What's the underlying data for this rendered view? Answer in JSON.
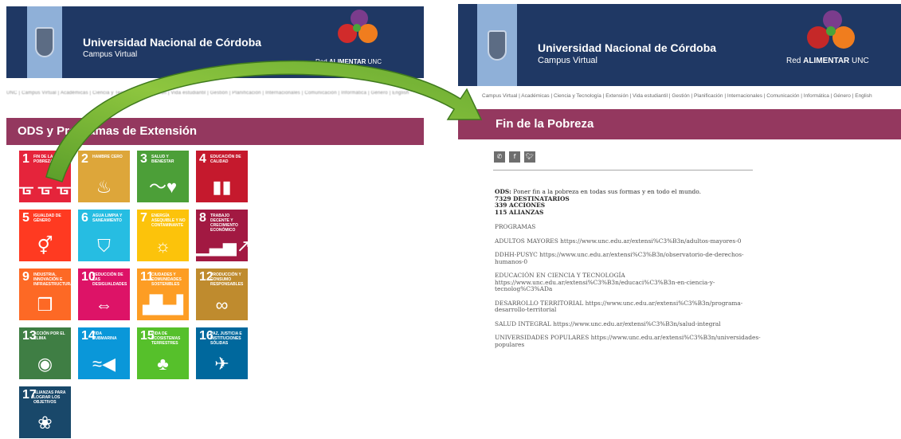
{
  "colors": {
    "header_bg": "#1f3864",
    "band_bg": "#94385f",
    "arrow_green": "#7dbb3a"
  },
  "left": {
    "header": {
      "title": "Universidad Nacional de Córdoba",
      "subtitle": "Campus Virtual",
      "logo_prefix": "Red ",
      "logo_bold": "ALIMENTAR",
      "logo_suffix": " UNC"
    },
    "nav_blurred": "UNC | Campus Virtual | Académicas | Ciencia y Tecnología | Extensión | Vida estudiantil | Gestión | Planificación | Internacionales | Comunicación | Informática | Género | English",
    "section_title": "ODS y Programas de Extensión",
    "tiles": [
      {
        "num": "1",
        "label": "Fin de la pobreza",
        "icon": "family-icon",
        "glyph": "ᚗ ᚗ ᚗ",
        "color": "#e5243b"
      },
      {
        "num": "2",
        "label": "Hambre cero",
        "icon": "bowl-icon",
        "glyph": "♨",
        "color": "#dda63a"
      },
      {
        "num": "3",
        "label": "Salud y bienestar",
        "icon": "heartbeat-icon",
        "glyph": "〜♥",
        "color": "#4c9f38"
      },
      {
        "num": "4",
        "label": "Educación de calidad",
        "icon": "book-icon",
        "glyph": "▮▮",
        "color": "#c5192d"
      },
      {
        "num": "5",
        "label": "Igualdad de género",
        "icon": "gender-icon",
        "glyph": "⚥",
        "color": "#ff3a21"
      },
      {
        "num": "6",
        "label": "Agua limpia y saneamiento",
        "icon": "water-icon",
        "glyph": "⛉",
        "color": "#26bde2"
      },
      {
        "num": "7",
        "label": "Energía asequible y no contaminante",
        "icon": "sun-icon",
        "glyph": "☼",
        "color": "#fcc30b"
      },
      {
        "num": "8",
        "label": "Trabajo decente y crecimiento económico",
        "icon": "growth-chart-icon",
        "glyph": "▁▃▅↗",
        "color": "#a21942"
      },
      {
        "num": "9",
        "label": "Industria, innovación e infraestructura",
        "icon": "cubes-icon",
        "glyph": "❒",
        "color": "#fd6925"
      },
      {
        "num": "10",
        "label": "Reducción de las desigualdades",
        "icon": "equality-icon",
        "glyph": "⇔",
        "color": "#dd1367"
      },
      {
        "num": "11",
        "label": "Ciudades y comunidades sostenibles",
        "icon": "city-icon",
        "glyph": "▟▙▟",
        "color": "#fd9d24"
      },
      {
        "num": "12",
        "label": "Producción y consumo responsables",
        "icon": "infinity-icon",
        "glyph": "∞",
        "color": "#bf8b2e"
      },
      {
        "num": "13",
        "label": "Acción por el clima",
        "icon": "eye-globe-icon",
        "glyph": "◉",
        "color": "#3f7e44"
      },
      {
        "num": "14",
        "label": "Vida submarina",
        "icon": "fish-icon",
        "glyph": "≈◀",
        "color": "#0a97d9"
      },
      {
        "num": "15",
        "label": "Vida de ecosistemas terrestres",
        "icon": "tree-icon",
        "glyph": "♣",
        "color": "#56c02b"
      },
      {
        "num": "16",
        "label": "Paz, justicia e instituciones sólidas",
        "icon": "dove-icon",
        "glyph": "✈",
        "color": "#00689d"
      },
      {
        "num": "17",
        "label": "Alianzas para lograr los objetivos",
        "icon": "flower-icon",
        "glyph": "❀",
        "color": "#19486a"
      }
    ]
  },
  "right": {
    "header": {
      "title": "Universidad Nacional de Córdoba",
      "subtitle": "Campus Virtual",
      "logo_prefix": "Red ",
      "logo_bold": "ALIMENTAR",
      "logo_suffix": " UNC"
    },
    "nav": [
      "Campus Virtual",
      "Académicas",
      "Ciencia y Tecnología",
      "Extensión",
      "Vida estudiantil",
      "Gestión",
      "Planificación",
      "Internacionales",
      "Comunicación",
      "Informática",
      "Género",
      "English"
    ],
    "section_title": "Fin de la Pobreza",
    "share": [
      "whatsapp-icon",
      "facebook-icon",
      "twitter-icon"
    ],
    "ods_label": "ODS:",
    "ods_text": " Poner fin a la pobreza en todas sus formas y en todo el mundo.",
    "stats": [
      "7329 DESTINATARIOS",
      "339 ACCIONES",
      "115 ALIANZAS"
    ],
    "programs_heading": "PROGRAMAS",
    "programs": [
      {
        "name": "ADULTOS MAYORES",
        "url": "https://www.unc.edu.ar/extensi%C3%B3n/adultos-mayores-0"
      },
      {
        "name": "DDHH-PUSYC",
        "url": "https://www.unc.edu.ar/extensi%C3%B3n/observatorio-de-derechos-humanos-0"
      },
      {
        "name": "EDUCACIÓN EN CIENCIA Y TECNOLOGÍA",
        "url": "https://www.unc.edu.ar/extensi%C3%B3n/educaci%C3%B3n-en-ciencia-y-tecnolog%C3%ADa"
      },
      {
        "name": "DESARROLLO TERRITORIAL",
        "url": "https://www.unc.edu.ar/extensi%C3%B3n/programa-desarrollo-territorial"
      },
      {
        "name": "SALUD INTEGRAL",
        "url": "https://www.unc.edu.ar/extensi%C3%B3n/salud-integral"
      },
      {
        "name": "UNIVERSIDADES POPULARES",
        "url": "https://www.unc.edu.ar/extensi%C3%B3n/universidades-populares"
      }
    ]
  }
}
